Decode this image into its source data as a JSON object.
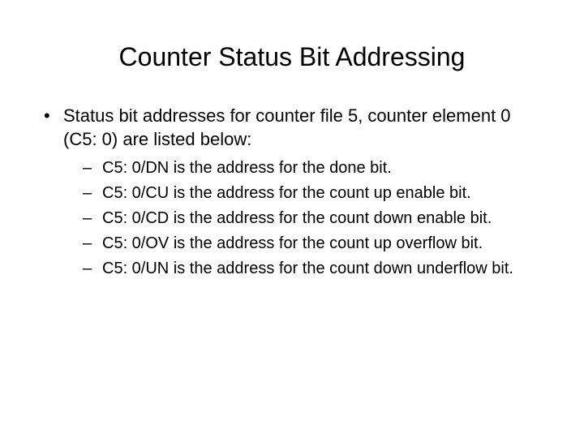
{
  "title": "Counter Status Bit Addressing",
  "intro": "Status bit addresses for counter file 5, counter element 0 (C5: 0) are listed below:",
  "items": [
    "C5: 0/DN is the address for the done bit.",
    "C5: 0/CU is the address for the count up enable bit.",
    "C5: 0/CD is the address for the count down enable bit.",
    "C5: 0/OV is the address for the count up overflow bit.",
    "C5: 0/UN is the address for the count down underflow bit."
  ]
}
